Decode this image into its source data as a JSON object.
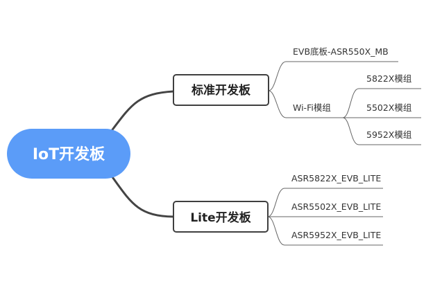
{
  "root": {
    "label": "IoT开发板"
  },
  "branches": [
    {
      "label": "标准开发板",
      "children": [
        {
          "label": "EVB底板-ASR550X_MB"
        },
        {
          "label": "Wi-Fi模组",
          "children": [
            {
              "label": "5822X模组"
            },
            {
              "label": "5502X模组"
            },
            {
              "label": "5952X模组"
            }
          ]
        }
      ]
    },
    {
      "label": "Lite开发板",
      "children": [
        {
          "label": "ASR5822X_EVB_LITE"
        },
        {
          "label": "ASR5502X_EVB_LITE"
        },
        {
          "label": "ASR5952X_EVB_LITE"
        }
      ]
    }
  ],
  "colors": {
    "root_fill": "#5b9cf8",
    "connector": "#444444",
    "node_border": "#3f3f3f"
  }
}
